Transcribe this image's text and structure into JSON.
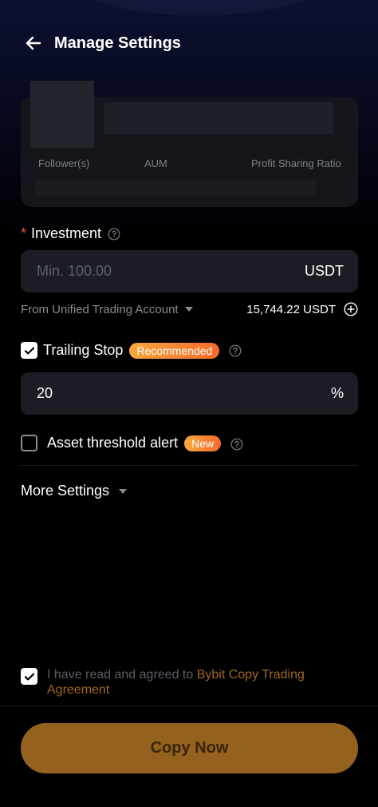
{
  "header": {
    "title": "Manage Settings"
  },
  "trader_card": {
    "stats": [
      "Follower(s)",
      "AUM",
      "Profit Sharing Ratio"
    ]
  },
  "investment": {
    "label": "Investment",
    "required_mark": "*",
    "placeholder": "Min. 100.00",
    "unit": "USDT",
    "source_label": "From Unified Trading Account",
    "balance": "15,744.22 USDT"
  },
  "trailing_stop": {
    "label": "Trailing Stop",
    "badge": "Recommended",
    "checked": true,
    "value": "20",
    "unit": "%"
  },
  "asset_alert": {
    "label": "Asset threshold alert",
    "badge": "New",
    "checked": false
  },
  "more_settings": {
    "label": "More Settings"
  },
  "agreement": {
    "text": "I have read and agreed to ",
    "link": "Bybit Copy Trading Agreement",
    "checked": true
  },
  "footer": {
    "button_label": "Copy Now"
  },
  "colors": {
    "accent": "#94611f",
    "badge_gradient_start": "#f7a83d",
    "badge_gradient_end": "#f56a2c",
    "required": "#f04a4a",
    "link": "#a26722"
  },
  "icons": [
    "arrow-left-icon",
    "help-icon",
    "caret-down-icon",
    "plus-circle-icon",
    "checkmark-icon"
  ]
}
